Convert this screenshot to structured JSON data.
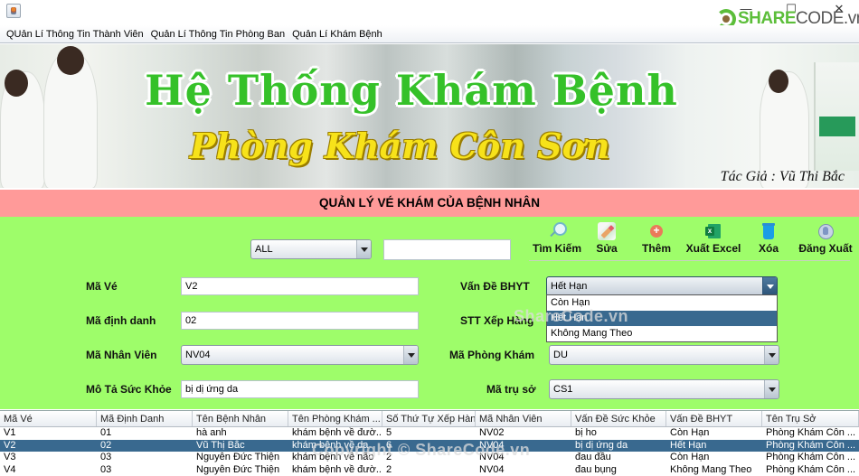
{
  "window": {
    "title": "",
    "controls": {
      "minimize": "—",
      "maximize": "☐",
      "close": "✕"
    },
    "watermark_logo": {
      "brand": "SHARE",
      "suffix": "CODE.vn"
    }
  },
  "menubar": {
    "items": [
      {
        "label": "QUản Lí Thông Tin Thành Viên"
      },
      {
        "label": "Quản Lí Thông Tin Phòng Ban"
      },
      {
        "label": "Quản Lí Khám Bệnh"
      }
    ]
  },
  "banner": {
    "title": "Hệ Thống Khám Bệnh",
    "subtitle": "Phòng Khám Côn Sơn",
    "author": "Tác Giả : Vũ Thi Bắc"
  },
  "section_title": "QUẢN LÝ VÉ KHÁM CỦA BỆNH NHÂN",
  "search": {
    "filter_selected": "ALL",
    "query_value": ""
  },
  "toolbar": {
    "buttons": [
      {
        "label": "Tìm Kiếm",
        "icon": "search-icon"
      },
      {
        "label": "Sửa",
        "icon": "edit-icon"
      },
      {
        "label": "Thêm",
        "icon": "add-icon"
      },
      {
        "label": "Xuất Excel",
        "icon": "excel-icon"
      },
      {
        "label": "Xóa",
        "icon": "trash-icon"
      },
      {
        "label": "Đăng Xuất",
        "icon": "logout-icon"
      }
    ]
  },
  "form": {
    "ma_ve": {
      "label": "Mã Vé",
      "value": "V2"
    },
    "ma_dinh_danh": {
      "label": "Mã định danh",
      "value": "02"
    },
    "ma_nhan_vien": {
      "label": "Mã Nhân Viên",
      "value": "NV04"
    },
    "mo_ta_suc_khoe": {
      "label": "Mô Tả Sức Khỏe",
      "value": "bị dị ứng da"
    },
    "van_de_bhyt": {
      "label": "Vấn Đề BHYT",
      "value": "Hết Hạn",
      "options": [
        "Còn Hạn",
        "Hết Hạn",
        "Không Mang Theo"
      ],
      "highlighted_index": 1
    },
    "stt_xep_hang": {
      "label": "STT Xếp Hàng",
      "value": ""
    },
    "ma_phong_kham": {
      "label": "Mã Phòng Khám",
      "value": "DU"
    },
    "ma_tru_so": {
      "label": "Mã trụ sở",
      "value": "CS1"
    }
  },
  "table": {
    "columns": [
      "Mã Vé",
      "Mã Định Danh",
      "Tên Bệnh Nhân",
      "Tên Phòng Khám ...",
      "Số Thứ Tự Xếp Hàng",
      "Mã Nhân Viên",
      "Vấn Đề Sức Khỏe",
      "Vấn Đề BHYT",
      "Tên Trụ Sở"
    ],
    "rows": [
      [
        "V1",
        "01",
        "hà anh",
        "khám bệnh về đườ...",
        "5",
        "NV02",
        "bị ho",
        "Còn Hạn",
        "Phòng Khám Côn ..."
      ],
      [
        "V2",
        "02",
        "Vũ Thị Bắc",
        "khám bệnh về da",
        "6",
        "NV04",
        "bị dị ứng da",
        "Hết Hạn",
        "Phòng Khám Côn ..."
      ],
      [
        "V3",
        "03",
        "Nguyễn Đức Thiện",
        "khám bệnh về não",
        "2",
        "NV04",
        "đau đầu",
        "Còn Hạn",
        "Phòng Khám Côn ..."
      ],
      [
        "V4",
        "03",
        "Nguyễn Đức Thiện",
        "khám bệnh về đườ...",
        "2",
        "NV04",
        "đau bụng",
        "Không Mang Theo",
        "Phòng Khám Côn ..."
      ]
    ],
    "selected_row_index": 1
  },
  "overlay_watermarks": {
    "mid": "ShareCode.vn",
    "bottom": "Copyright © ShareCode.vn"
  },
  "colors": {
    "form_background": "#9efd6a",
    "section_title_background": "#ff9a99",
    "selection": "#39698f",
    "banner_title_green": "#35c129",
    "banner_subtitle_yellow": "#f7e21a"
  }
}
